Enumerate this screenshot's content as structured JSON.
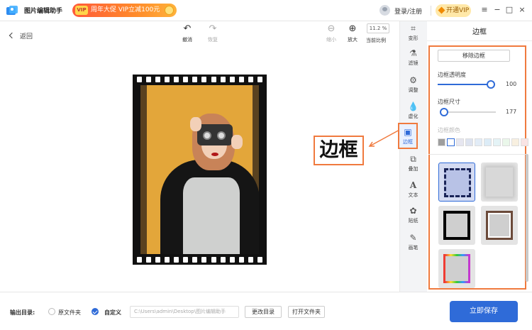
{
  "app": {
    "name": "图片编辑助手",
    "promo_text": "周年大促 VIP立减100元",
    "promo_tag": "VIP",
    "login_text": "登录/注册",
    "vip_button": "开通VIP",
    "window_controls": [
      "≡",
      "−",
      "□",
      "×"
    ]
  },
  "toolbar": {
    "back_label": "返回",
    "undo_label": "撤消",
    "redo_label": "恢复",
    "zoom_out_label": "缩小",
    "zoom_in_label": "放大",
    "zoom_value": "11.2 %",
    "current_ratio_label": "当前比例"
  },
  "callout": {
    "text": "边框",
    "color": "#f07a3e"
  },
  "tools": [
    {
      "label": "变形",
      "icon": "crop-icon"
    },
    {
      "label": "滤镜",
      "icon": "filter-icon"
    },
    {
      "label": "调整",
      "icon": "adjust-icon"
    },
    {
      "label": "虚化",
      "icon": "blur-icon"
    },
    {
      "label": "边框",
      "icon": "frame-icon",
      "active": true
    },
    {
      "label": "叠加",
      "icon": "overlay-icon"
    },
    {
      "label": "文本",
      "icon": "text-icon"
    },
    {
      "label": "贴纸",
      "icon": "sticker-icon"
    },
    {
      "label": "画笔",
      "icon": "brush-icon"
    }
  ],
  "panel": {
    "title": "边框",
    "remove_button": "移除边框",
    "opacity_label": "边框透明度",
    "opacity_value": "100",
    "opacity_fraction": 1.0,
    "size_label": "边框尺寸",
    "size_value": "177",
    "size_fraction": 0.0,
    "color_label": "边框颜色",
    "swatches": [
      "#9e9e9e",
      "#ffffff",
      "#e6e6f0",
      "#dde3f0",
      "#e2ecf7",
      "#dcecf7",
      "#e4f3f6",
      "#eaf7ea",
      "#f8f0e0",
      "#f9e4e4"
    ]
  },
  "bottom": {
    "output_label": "输出目录:",
    "option_original": "原文件夹",
    "option_custom": "自定义",
    "path_value": "C:\\Users\\admin\\Desktop\\图片编辑助手",
    "change_dir_button": "更改目录",
    "open_folder_button": "打开文件夹",
    "save_button": "立即保存"
  },
  "colors": {
    "accent": "#2f6bd8",
    "highlight": "#f07a3e"
  }
}
